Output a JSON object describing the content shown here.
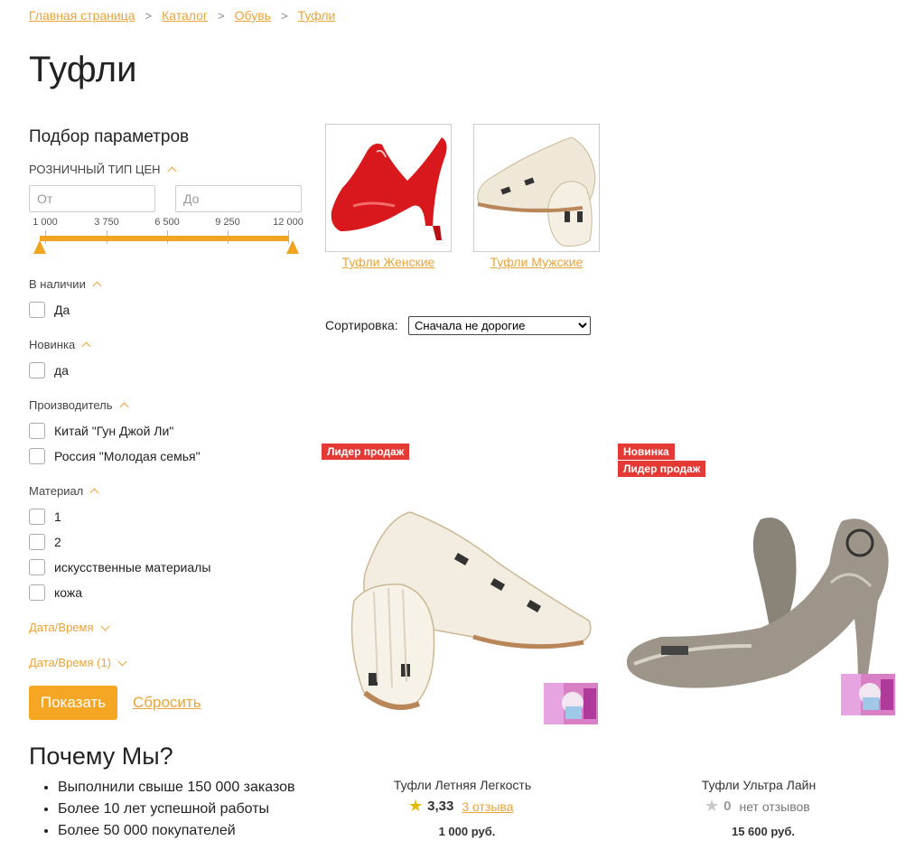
{
  "breadcrumb": [
    "Главная страница",
    "Каталог",
    "Обувь",
    "Туфли"
  ],
  "page_title": "Туфли",
  "filter": {
    "title": "Подбор параметров",
    "price": {
      "heading": "РОЗНИЧНЫЙ ТИП ЦЕН",
      "from_placeholder": "От",
      "to_placeholder": "До",
      "ticks": [
        "1 000",
        "3 750",
        "6 500",
        "9 250",
        "12 000"
      ]
    },
    "in_stock": {
      "heading": "В наличии",
      "options": [
        "Да"
      ]
    },
    "novelty": {
      "heading": "Новинка",
      "options": [
        "да"
      ]
    },
    "manufacturer": {
      "heading": "Производитель",
      "options": [
        "Китай \"Гун Джой Ли\"",
        "Россия \"Молодая семья\""
      ]
    },
    "material": {
      "heading": "Материал",
      "options": [
        "1",
        "2",
        "искусственные материалы",
        "кожа"
      ]
    },
    "datetime1": "Дата/Время",
    "datetime2": "Дата/Время (1)",
    "show_button": "Показать",
    "reset_link": "Сбросить"
  },
  "why_us": {
    "title": "Почему Мы?",
    "items": [
      "Выполнили свыше 150 000 заказов",
      "Более 10 лет успешной работы",
      "Более 50 000 покупателей"
    ]
  },
  "categories": [
    {
      "label": "Туфли Женские"
    },
    {
      "label": "Туфли Мужские"
    }
  ],
  "sort": {
    "label": "Сортировка:",
    "selected": "Сначала не дорогие"
  },
  "products": [
    {
      "badges": [
        "Лидер продаж"
      ],
      "name": "Туфли Летняя Легкость",
      "rating": "3,33",
      "reviews": "3 отзыва",
      "price": "1 000 руб."
    },
    {
      "badges": [
        "Новинка",
        "Лидер продаж"
      ],
      "name": "Туфли Ультра Лайн",
      "rating": "0",
      "reviews": "нет отзывов",
      "price": "15 600 руб."
    }
  ],
  "colors": {
    "accent": "#f5a623",
    "badge": "#e53935",
    "star": "#e6b800"
  }
}
